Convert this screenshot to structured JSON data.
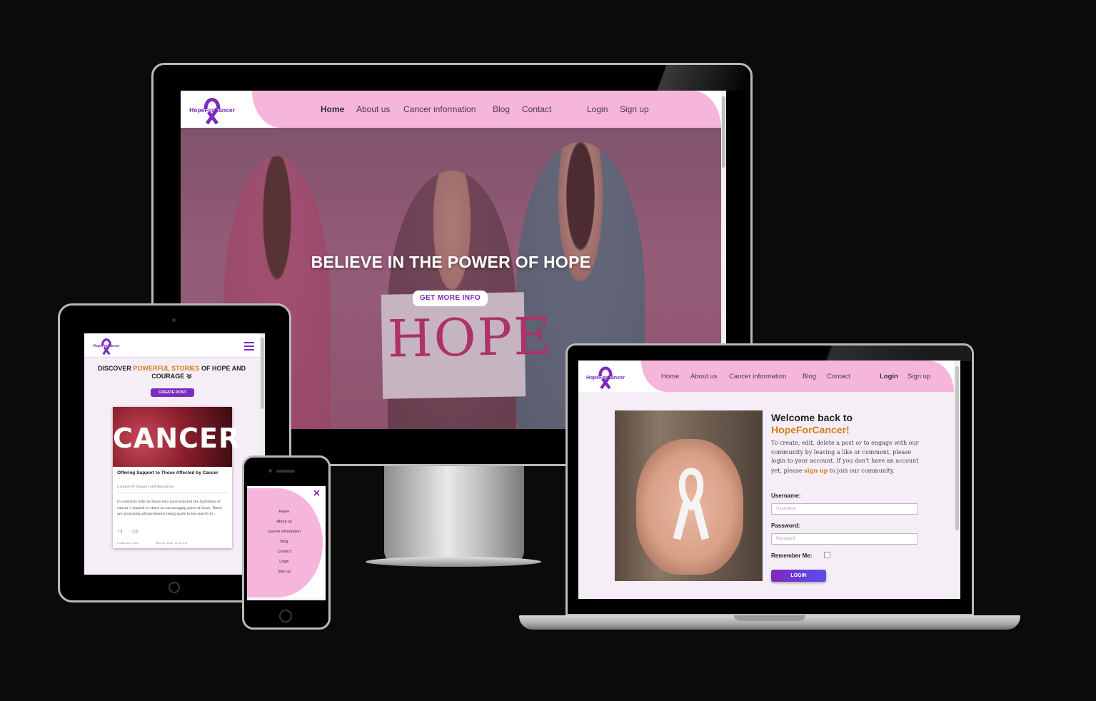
{
  "brand": {
    "name": "HopeForCancer",
    "purple": "#7b2bbd",
    "pink": "#f6b6dc",
    "orange": "#d77a1c"
  },
  "desktop": {
    "nav": {
      "home": "Home",
      "about": "About us",
      "cancer_info": "Cancer information",
      "blog": "Blog",
      "contact": "Contact",
      "login": "Login",
      "signup": "Sign up"
    },
    "hero": {
      "title": "BELIEVE IN THE POWER OF HOPE",
      "button": "GET MORE INFO",
      "sign_word": "HOPE"
    }
  },
  "tablet": {
    "heading_pre": "DISCOVER ",
    "heading_highlight": "POWERFUL STORIES",
    "heading_post": " OF HOPE AND COURAGE",
    "heading_icon": "double-chevron-down-icon",
    "create_button": "CREATE POST",
    "post": {
      "image_text": "CANCER",
      "title": "Offering Support to Those Affected by Cancer",
      "category": "Category# Support and Resources",
      "excerpt": "In solidarity with all those who have endured the hardships of cancer, I wanted to share an encouraging piece of news. There are promising advancements being made in the search fo...",
      "likes": "2",
      "comments": "1",
      "posted_by": "Posted by: Conor",
      "date": "May 23, 2023, 12:44 p.m."
    }
  },
  "phone": {
    "menu": [
      "Home",
      "About us",
      "Cancer information",
      "Blog",
      "Contact",
      "Login",
      "Sign up"
    ],
    "close_icon": "close-icon"
  },
  "laptop": {
    "nav": {
      "home": "Home",
      "about": "About us",
      "cancer_info": "Cancer information",
      "blog": "Blog",
      "contact": "Contact",
      "login": "Login",
      "signup": "Sign up"
    },
    "welcome_line1": "Welcome back to",
    "welcome_line2": "HopeForCancer!",
    "intro_pre": "To create, edit, delete a post or to engage with our community by leaving a like or comment, please login to your account. If you don't have an account yet, please ",
    "intro_link": "sign up",
    "intro_post": " to join our community.",
    "username_label": "Username:",
    "username_placeholder": "Username",
    "password_label": "Password:",
    "password_placeholder": "Password",
    "remember_label": "Remember Me:",
    "login_button": "LOGIN"
  }
}
